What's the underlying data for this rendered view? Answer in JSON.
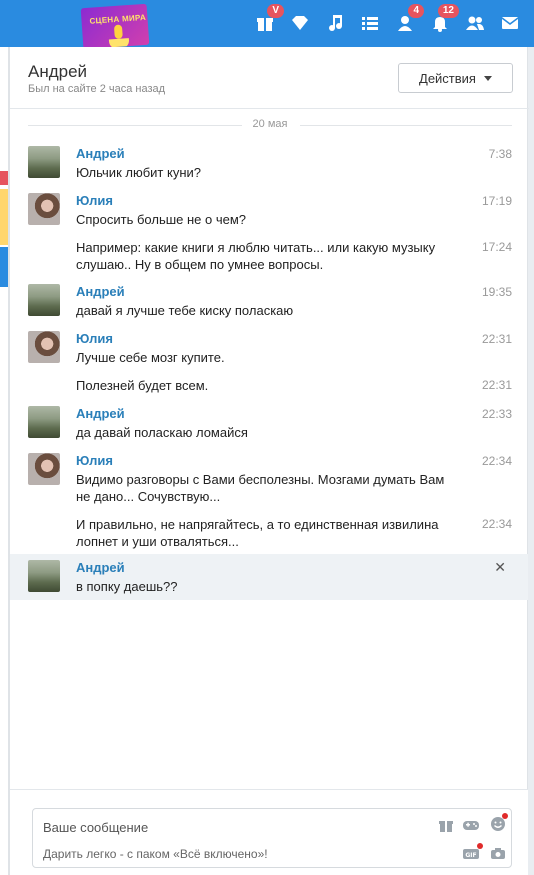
{
  "topbar": {
    "promo_text": "СЦЕНА МИРА",
    "icons": [
      {
        "name": "gift-icon",
        "badge": "V"
      },
      {
        "name": "diamond-icon",
        "badge": ""
      },
      {
        "name": "music-icon",
        "badge": ""
      },
      {
        "name": "list-icon",
        "badge": ""
      },
      {
        "name": "guests-icon",
        "badge": "4"
      },
      {
        "name": "bell-icon",
        "badge": "12"
      },
      {
        "name": "friends-icon",
        "badge": ""
      },
      {
        "name": "mail-icon",
        "badge": ""
      }
    ],
    "accent": "#2a8be0"
  },
  "header": {
    "contact_name": "Андрей",
    "status": "Был на сайте 2 часа назад",
    "actions_label": "Действия"
  },
  "date_separator": "20 мая",
  "messages": [
    {
      "author": "Андрей",
      "text": "Юльчик любит куни?",
      "time": "7:38"
    },
    {
      "author": "Юлия",
      "text": "Спросить больше не о чем?",
      "time": "17:19"
    },
    {
      "author": "",
      "text": "Например: какие книги я люблю читать... или какую музыку слушаю.. Ну в общем по умнее вопросы.",
      "time": "17:24"
    },
    {
      "author": "Андрей",
      "text": "давай я лучше тебе киску поласкаю",
      "time": "19:35"
    },
    {
      "author": "Юлия",
      "text": "Лучше себе мозг купите.",
      "time": "22:31"
    },
    {
      "author": "",
      "text": "Полезней будет всем.",
      "time": "22:31"
    },
    {
      "author": "Андрей",
      "text": "да давай поласкаю ломайся",
      "time": "22:33"
    },
    {
      "author": "Юлия",
      "text": "Видимо разговоры с Вами бесполезны. Мозгами думать Вам не дано... Сочувствую...",
      "time": "22:34"
    },
    {
      "author": "",
      "text": "И правильно, не напрягайтесь, а то единственная извилина лопнет и уши отваляться...",
      "time": "22:34"
    },
    {
      "author": "Андрей",
      "text": "в попку даешь??",
      "time": ""
    }
  ],
  "composer": {
    "placeholder": "Ваше сообщение",
    "hint": "Дарить легко - с паком «Всё включено»!"
  }
}
